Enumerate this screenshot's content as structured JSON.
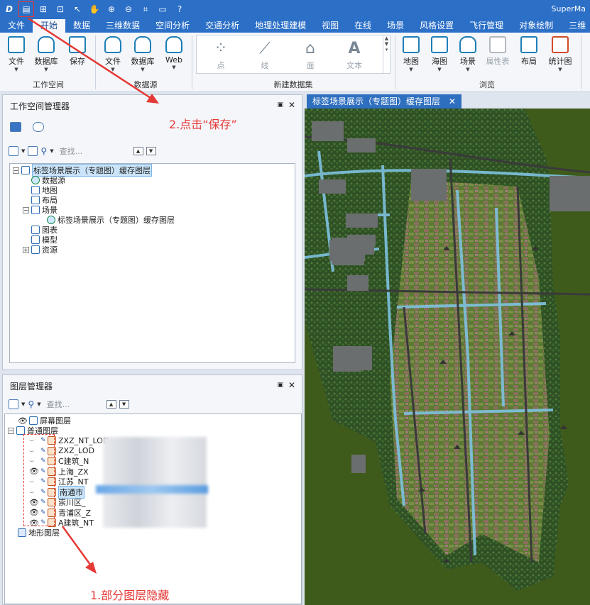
{
  "window": {
    "title": "SuperMa"
  },
  "quick_access": [
    "app-logo-icon",
    "save-icon",
    "new-icon",
    "open-icon",
    "select-icon",
    "pan-icon",
    "zoom-in-icon",
    "zoom-out-icon",
    "full-extent-icon",
    "folder-icon",
    "help-icon"
  ],
  "menu": {
    "file": "文件",
    "start": "开始",
    "data": "数据",
    "3d_data": "三维数据",
    "spatial": "空间分析",
    "traffic": "交通分析",
    "geoprocess": "地理处理建模",
    "view": "视图",
    "online": "在线",
    "scene": "场景",
    "style": "风格设置",
    "flight": "飞行管理",
    "object": "对象绘制",
    "more": "三维"
  },
  "ribbon": {
    "workspace": {
      "file": "文件",
      "database": "数据库",
      "save": "保存",
      "group": "工作空间"
    },
    "datasource": {
      "file": "文件",
      "database": "数据库",
      "web": "Web",
      "group": "数据源"
    },
    "new_dataset": {
      "point": "点",
      "line": "线",
      "region": "面",
      "text": "文本",
      "group": "新建数据集"
    },
    "browse": {
      "map": "地图",
      "chart": "海图",
      "scene": "场景",
      "attr": "属性表",
      "layout": "布局",
      "statmap": "统计图",
      "group": "浏览"
    }
  },
  "workspace_manager": {
    "title": "工作空间管理器",
    "search_placeholder": "查找...",
    "tree": {
      "root": "标签场景展示（专题图）缓存图层",
      "datasource": "数据源",
      "map": "地图",
      "layout": "布局",
      "scene": "场景",
      "scene_child": "标签场景展示（专题图）缓存图层",
      "chart": "图表",
      "model": "模型",
      "resource": "资源"
    }
  },
  "layer_manager": {
    "title": "图层管理器",
    "search_placeholder": "查找...",
    "screen_layer": "屏幕图层",
    "normal_layer": "普通图层",
    "terrain_layer": "地形图层",
    "layers": [
      {
        "name": "ZXZ_NT_LOD",
        "visible": false
      },
      {
        "name": "ZXZ_LOD",
        "visible": false
      },
      {
        "name": "C建筑_N",
        "visible": false
      },
      {
        "name": "上海_ZX",
        "visible": true
      },
      {
        "name": "江苏_NT",
        "visible": false
      },
      {
        "name": "南通市",
        "visible": false,
        "selected": true
      },
      {
        "name": "崇川区_",
        "visible": true
      },
      {
        "name": "青浦区_Z",
        "visible": true
      },
      {
        "name": "A建筑_NT",
        "visible": true
      }
    ]
  },
  "scene_tab": {
    "title": "标签场景展示（专题图）缓存图层"
  },
  "annotations": {
    "step1": "1.部分图层隐藏",
    "step2": "2.点击“保存”"
  },
  "colors": {
    "titlebar": "#2b6fc7",
    "annotation": "#e53935",
    "terrain": "#3e5a19"
  }
}
